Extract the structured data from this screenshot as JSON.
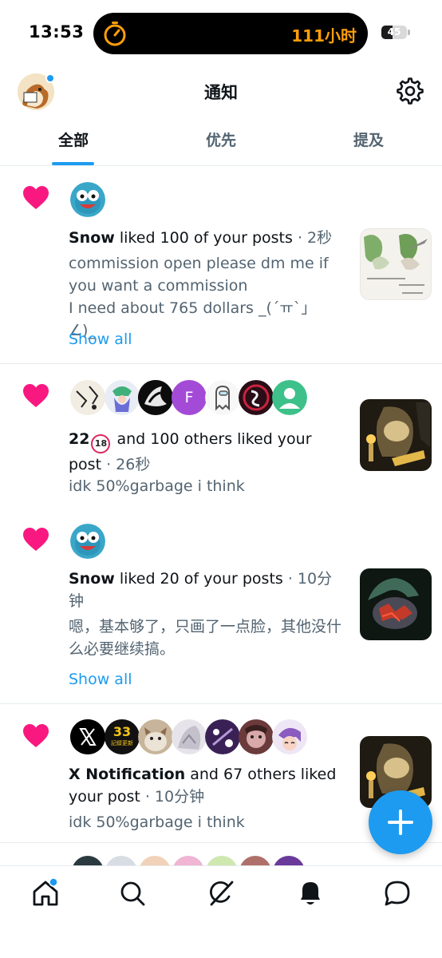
{
  "status_bar": {
    "time": "13:53",
    "timer_text": "111小时",
    "battery_level": "45"
  },
  "header": {
    "title": "通知"
  },
  "tabs": [
    {
      "label": "全部",
      "active": true
    },
    {
      "label": "优先",
      "active": false
    },
    {
      "label": "提及",
      "active": false
    }
  ],
  "notifications": [
    {
      "type": "like",
      "actor": "Snow",
      "action": " liked 100 of your posts",
      "time": " · 2秒",
      "snippet": "commission open please dm me if you want a commission\nI need about 765 dollars _(´ㅠ`」 ∠)_",
      "show_all": "Show all"
    },
    {
      "type": "like",
      "actor": "22",
      "actor_badge": "🔞",
      "action": " and 100 others liked your post",
      "time": " · 26秒",
      "snippet": "idk 50%garbage i think",
      "avatar_extra_letter": "F"
    },
    {
      "type": "like",
      "actor": "Snow",
      "action": " liked 20 of your posts",
      "time": " · 10分钟",
      "snippet": "嗯，基本够了，只画了一点脸，其他没什么必要继续搞。",
      "show_all": "Show all"
    },
    {
      "type": "like",
      "actor": "X Notification",
      "action": " and 67 others liked your post",
      "time": " · 10分钟",
      "snippet": "idk 50%garbage i think",
      "badge_33": "33",
      "badge_33_sub": "記録更新"
    }
  ],
  "colors": {
    "accent": "#1d9bf0",
    "heart": "#f91880",
    "text_primary": "#0f1419",
    "text_secondary": "#536471",
    "timer": "#ff9f0a"
  },
  "nav": [
    {
      "icon": "home-icon"
    },
    {
      "icon": "search-icon"
    },
    {
      "icon": "grok-icon"
    },
    {
      "icon": "bell-icon"
    },
    {
      "icon": "message-icon"
    }
  ]
}
